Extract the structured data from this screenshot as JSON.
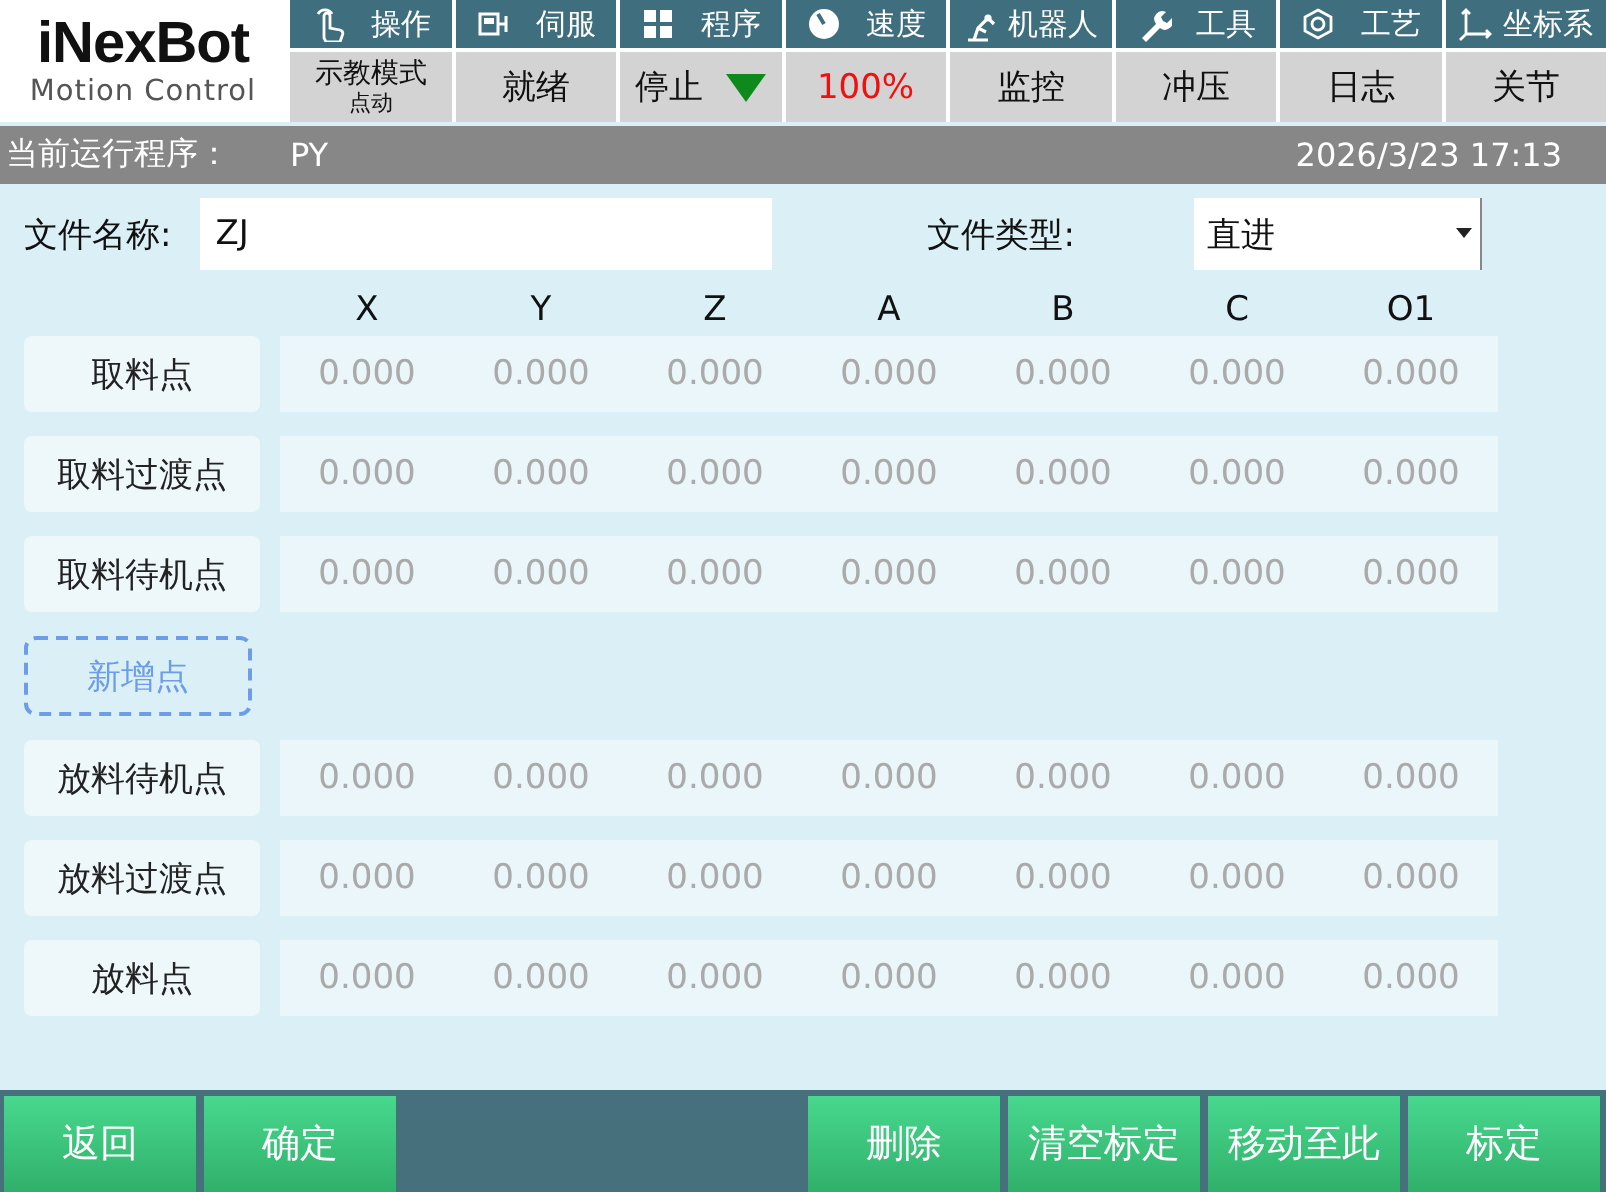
{
  "logo": {
    "brand": "iNexBot",
    "tagline": "Motion Control"
  },
  "menu_tabs": [
    {
      "label": "操作"
    },
    {
      "label": "伺服"
    },
    {
      "label": "程序"
    },
    {
      "label": "速度"
    },
    {
      "label": "机器人"
    },
    {
      "label": "工具"
    },
    {
      "label": "工艺"
    },
    {
      "label": "坐标系"
    }
  ],
  "status_cells": [
    {
      "kind": "mode",
      "label": "示教模式",
      "sub": "点动"
    },
    {
      "kind": "text",
      "label": "就绪"
    },
    {
      "kind": "run_state",
      "label": "停止"
    },
    {
      "kind": "speed",
      "label": "100%"
    },
    {
      "kind": "text",
      "label": "监控"
    },
    {
      "kind": "text",
      "label": "冲压"
    },
    {
      "kind": "text",
      "label": "日志"
    },
    {
      "kind": "text",
      "label": "关节"
    }
  ],
  "program_bar": {
    "label": "当前运行程序：",
    "program": "PY",
    "datetime": "2026/3/23 17:13"
  },
  "file": {
    "name_label": "文件名称:",
    "name_value": "ZJ",
    "type_label": "文件类型:",
    "type_value": "直进"
  },
  "table": {
    "columns": [
      "X",
      "Y",
      "Z",
      "A",
      "B",
      "C",
      "O1"
    ],
    "rows": [
      {
        "kind": "point",
        "label": "取料点",
        "values": [
          "0.000",
          "0.000",
          "0.000",
          "0.000",
          "0.000",
          "0.000",
          "0.000"
        ]
      },
      {
        "kind": "point",
        "label": "取料过渡点",
        "values": [
          "0.000",
          "0.000",
          "0.000",
          "0.000",
          "0.000",
          "0.000",
          "0.000"
        ]
      },
      {
        "kind": "point",
        "label": "取料待机点",
        "values": [
          "0.000",
          "0.000",
          "0.000",
          "0.000",
          "0.000",
          "0.000",
          "0.000"
        ]
      },
      {
        "kind": "add",
        "label": "新增点"
      },
      {
        "kind": "point",
        "label": "放料待机点",
        "values": [
          "0.000",
          "0.000",
          "0.000",
          "0.000",
          "0.000",
          "0.000",
          "0.000"
        ]
      },
      {
        "kind": "point",
        "label": "放料过渡点",
        "values": [
          "0.000",
          "0.000",
          "0.000",
          "0.000",
          "0.000",
          "0.000",
          "0.000"
        ]
      },
      {
        "kind": "point",
        "label": "放料点",
        "values": [
          "0.000",
          "0.000",
          "0.000",
          "0.000",
          "0.000",
          "0.000",
          "0.000"
        ]
      }
    ]
  },
  "footer": {
    "left": [
      "返回",
      "确定"
    ],
    "right": [
      "删除",
      "清空标定",
      "移动至此",
      "标定"
    ]
  }
}
